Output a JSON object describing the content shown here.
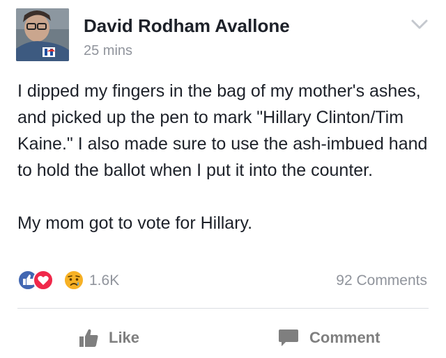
{
  "post": {
    "author": "David Rodham Avallone",
    "timestamp": "25 mins",
    "text": "I dipped my fingers in the bag of my mother's ashes, and picked up the pen to mark \"Hillary Clinton/Tim Kaine.\" I also made sure to use the ash-imbued hand to hold the ballot when I put it into the counter.\n\nMy mom got to vote for Hillary."
  },
  "reactions": {
    "icons": [
      "like-reaction-icon",
      "love-reaction-icon",
      "sad-reaction-icon"
    ],
    "count": "1.6K",
    "comments": "92 Comments",
    "colors": {
      "like": "#4267b2",
      "love": "#f0284a",
      "sad": "#f7b125"
    }
  },
  "actions": {
    "like_label": "Like",
    "comment_label": "Comment"
  },
  "colors": {
    "text": "#1d2129",
    "meta": "#90949c",
    "action": "#7f7f7f",
    "divider": "#dadde1"
  }
}
